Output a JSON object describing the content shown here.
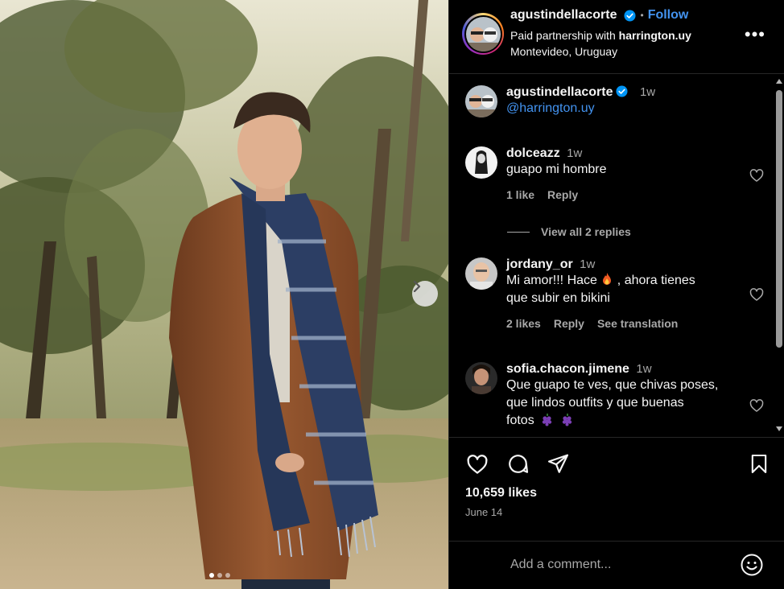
{
  "post": {
    "author": "agustindellacorte",
    "follow_label": "Follow",
    "separator": "•",
    "partnership_prefix": "Paid partnership with ",
    "partner": "harrington.uy",
    "location": "Montevideo, Uruguay",
    "more_label": "•••"
  },
  "caption": {
    "username": "agustindellacorte",
    "time": "1w",
    "text": "@harrington.uy"
  },
  "comments": [
    {
      "username": "dolceazz",
      "time": "1w",
      "text": "guapo mi hombre",
      "likes": "1 like",
      "reply": "Reply"
    },
    {
      "username": "jordany_or",
      "time": "1w",
      "text_a": "Mi amor!!! Hace ",
      "text_b": " , ahora tienes",
      "text_c": "que subir en bikini",
      "likes": "2 likes",
      "reply": "Reply",
      "translate": "See translation"
    },
    {
      "username": "sofia.chacon.jimene",
      "time": "1w",
      "line1": "Que guapo te ves, que chivas poses,",
      "line2": "que lindos outfits y que buenas",
      "line3": "fotos"
    }
  ],
  "view_replies": "View all 2 replies",
  "likes_count": "10,659 likes",
  "date": "June 14",
  "comment_placeholder": "Add a comment...",
  "carousel": {
    "slide_count": 3,
    "active_index": 0
  },
  "colors": {
    "accent": "#4393f0",
    "muted": "#a8a8a8",
    "background": "#000000"
  }
}
